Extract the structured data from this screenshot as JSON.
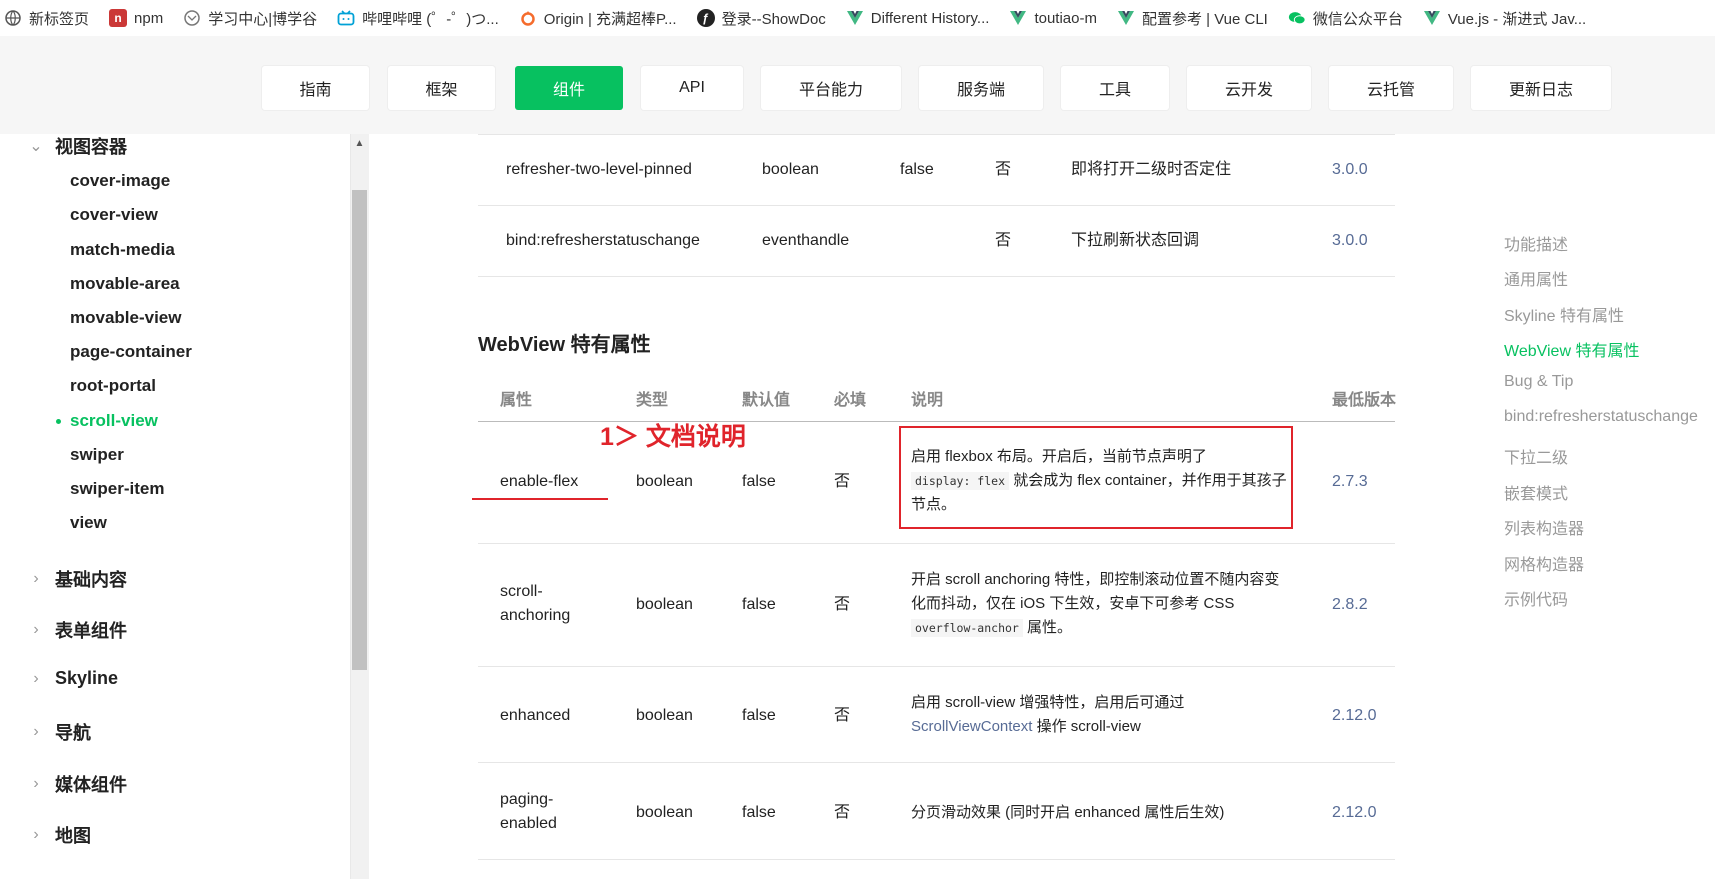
{
  "bookmarks": [
    {
      "label": "新标签页",
      "icon": "globe-icon",
      "color": "#555555"
    },
    {
      "label": "npm",
      "icon": "npm-icon",
      "color": "#cb3837"
    },
    {
      "label": "学习中心|博学谷",
      "icon": "globe-icon",
      "color": "#777777"
    },
    {
      "label": "哔哩哔哩 (゜-゜)つ...",
      "icon": "bilibili-icon",
      "color": "#00a1d6"
    },
    {
      "label": "Origin | 充满超棒P...",
      "icon": "origin-icon",
      "color": "#f56c2d"
    },
    {
      "label": "登录--ShowDoc",
      "icon": "showdoc-icon",
      "color": "#222222"
    },
    {
      "label": "Different History...",
      "icon": "vue-icon",
      "color": "#41b883"
    },
    {
      "label": "toutiao-m",
      "icon": "vue-icon",
      "color": "#41b883"
    },
    {
      "label": "配置参考 | Vue CLI",
      "icon": "vue-icon",
      "color": "#41b883"
    },
    {
      "label": "微信公众平台",
      "icon": "wechat-icon",
      "color": "#07c160"
    },
    {
      "label": "Vue.js - 渐进式 Jav...",
      "icon": "vue-icon",
      "color": "#41b883"
    }
  ],
  "topnav": {
    "items": [
      "指南",
      "框架",
      "组件",
      "API",
      "平台能力",
      "服务端",
      "工具",
      "云开发",
      "云托管",
      "更新日志"
    ],
    "active": "组件",
    "accent": "#07c160"
  },
  "sidebar": {
    "current_group": "视图容器",
    "items": [
      "cover-image",
      "cover-view",
      "match-media",
      "movable-area",
      "movable-view",
      "page-container",
      "root-portal",
      "scroll-view",
      "swiper",
      "swiper-item",
      "view"
    ],
    "active_item": "scroll-view",
    "groups": [
      "基础内容",
      "表单组件",
      "Skyline",
      "导航",
      "媒体组件",
      "地图"
    ]
  },
  "prev_table": {
    "rows": [
      {
        "attr": "refresher-two-level-pinned",
        "type": "boolean",
        "default": "false",
        "required": "否",
        "desc": "即将打开二级时否定住",
        "version": "3.0.0"
      },
      {
        "attr": "bind:refresherstatuschange",
        "type": "eventhandle",
        "default": "",
        "required": "否",
        "desc": "下拉刷新状态回调",
        "version": "3.0.0"
      }
    ]
  },
  "section": {
    "title": "WebView 特有属性",
    "headers": {
      "attr": "属性",
      "type": "类型",
      "default": "默认值",
      "required": "必填",
      "desc": "说明",
      "version": "最低版本"
    },
    "annotation": "1＞ 文档说明",
    "rows": [
      {
        "attr": "enable-flex",
        "type": "boolean",
        "default": "false",
        "required": "否",
        "desc_a": "启用 flexbox 布局。开启后，当前节点声明了",
        "desc_code": "display: flex",
        "desc_b": "就会成为 flex container，并作用于其孩子节点。",
        "version": "2.7.3"
      },
      {
        "attr_a": "scroll-",
        "attr_b": "anchoring",
        "type": "boolean",
        "default": "false",
        "required": "否",
        "desc_a": "开启 scroll anchoring 特性，即控制滚动位置不随内容变化而抖动，仅在 iOS 下生效，安卓下可参考 CSS",
        "desc_code": "overflow-anchor",
        "desc_b": "属性。",
        "version": "2.8.2"
      },
      {
        "attr": "enhanced",
        "type": "boolean",
        "default": "false",
        "required": "否",
        "desc_a": "启用 scroll-view 增强特性，启用后可通过",
        "desc_link": "ScrollViewContext",
        "desc_b": "操作 scroll-view",
        "version": "2.12.0"
      },
      {
        "attr_a": "paging-",
        "attr_b": "enabled",
        "type": "boolean",
        "default": "false",
        "required": "否",
        "desc": "分页滑动效果 (同时开启 enhanced 属性后生效)",
        "version": "2.12.0"
      }
    ]
  },
  "toc": {
    "items": [
      "功能描述",
      "通用属性",
      "Skyline 特有属性",
      "WebView 特有属性",
      "Bug & Tip",
      "bind:refresherstatuschange",
      "下拉二级",
      "嵌套模式",
      "列表构造器",
      "网格构造器",
      "示例代码"
    ],
    "active": "WebView 特有属性"
  }
}
